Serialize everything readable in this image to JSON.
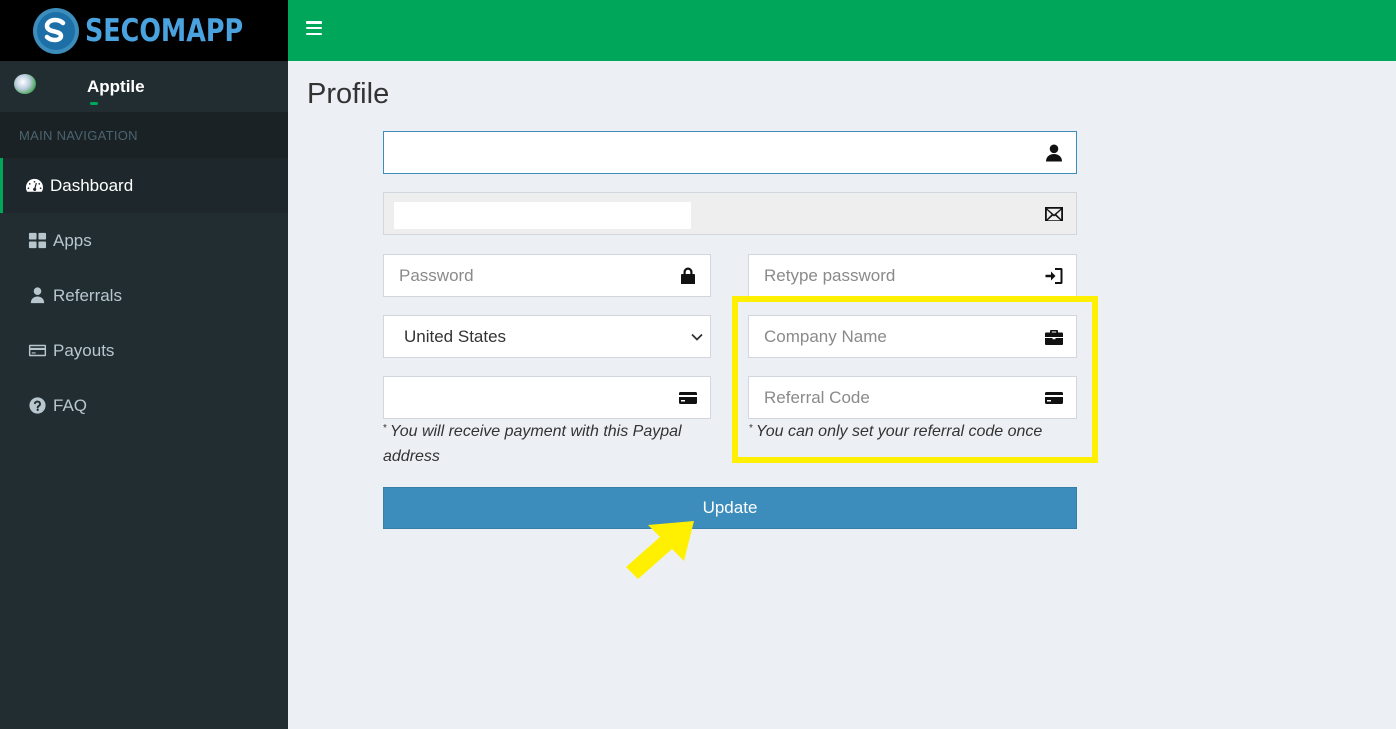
{
  "brand": {
    "logo_text": "SECOMAPP"
  },
  "user": {
    "name": "Apptile"
  },
  "sidebar": {
    "header": "MAIN NAVIGATION",
    "items": [
      {
        "label": "Dashboard",
        "icon": "dashboard-icon",
        "active": true
      },
      {
        "label": "Apps",
        "icon": "grid-icon"
      },
      {
        "label": "Referrals",
        "icon": "user-icon"
      },
      {
        "label": "Payouts",
        "icon": "credit-card-icon"
      },
      {
        "label": "FAQ",
        "icon": "question-circle-icon"
      }
    ]
  },
  "page": {
    "title": "Profile"
  },
  "form": {
    "name": {
      "value": "",
      "placeholder": ""
    },
    "email": {
      "value": "",
      "placeholder": ""
    },
    "password": {
      "placeholder": "Password"
    },
    "retype_password": {
      "placeholder": "Retype password"
    },
    "country": {
      "selected": "United States"
    },
    "company": {
      "placeholder": "Company Name"
    },
    "paypal": {
      "value": "",
      "placeholder": "",
      "hint_mark": "*",
      "hint": "You will receive payment with this Paypal address"
    },
    "referral": {
      "placeholder": "Referral Code",
      "hint_mark": "*",
      "hint": "You can only set your referral code once"
    },
    "submit_label": "Update"
  },
  "colors": {
    "header": "#00a65a",
    "sidebar": "#222d32",
    "button": "#3c8dbc",
    "highlight": "#ffef00"
  }
}
